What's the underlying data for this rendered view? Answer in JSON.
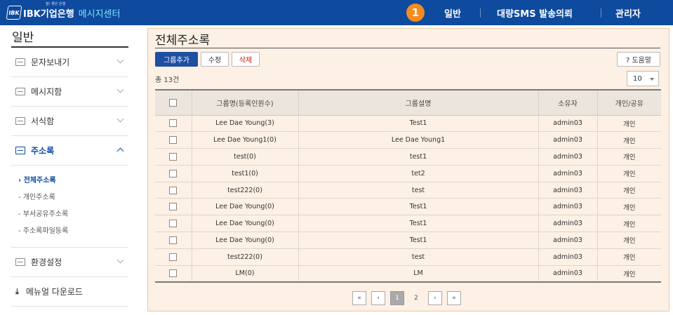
{
  "header": {
    "logo_badge": "IBK",
    "logo_tagline": "참! 좋은 은행",
    "logo_bank": "IBK기업은행",
    "logo_center": "메시지센터",
    "callout_number": "1",
    "nav": [
      {
        "label": "일반"
      },
      {
        "label": "대량SMS 발송의뢰"
      },
      {
        "label": "관리자"
      }
    ]
  },
  "sidebar": {
    "title": "일반",
    "items": [
      {
        "label": "문자보내기"
      },
      {
        "label": "메시지함"
      },
      {
        "label": "서식함"
      },
      {
        "label": "주소록"
      },
      {
        "label": "환경설정"
      },
      {
        "label": "메뉴얼 다운로드"
      }
    ],
    "sub_items": [
      {
        "label": "› 전체주소록"
      },
      {
        "label": "- 개인주소록"
      },
      {
        "label": "- 부서공유주소록"
      },
      {
        "label": "- 주소록파일등록"
      }
    ]
  },
  "main": {
    "title": "전체주소록",
    "buttons": {
      "add_group": "그룹추가",
      "edit": "수정",
      "delete": "삭제",
      "help": "? 도움말"
    },
    "total": "총 13건",
    "page_size": "10",
    "table": {
      "headers": [
        "그룹명(등록인원수)",
        "그룹설명",
        "소유자",
        "개인/공유"
      ],
      "rows": [
        [
          "Lee Dae Young(3)",
          "Test1",
          "admin03",
          "개인"
        ],
        [
          "Lee Dae Young1(0)",
          "Lee Dae Young1",
          "admin03",
          "개인"
        ],
        [
          "test(0)",
          "test1",
          "admin03",
          "개인"
        ],
        [
          "test1(0)",
          "tet2",
          "admin03",
          "개인"
        ],
        [
          "test222(0)",
          "test",
          "admin03",
          "개인"
        ],
        [
          "Lee Dae Young(0)",
          "Test1",
          "admin03",
          "개인"
        ],
        [
          "Lee Dae Young(0)",
          "Test1",
          "admin03",
          "개인"
        ],
        [
          "Lee Dae Young(0)",
          "Test1",
          "admin03",
          "개인"
        ],
        [
          "test222(0)",
          "test",
          "admin03",
          "개인"
        ],
        [
          "LM(0)",
          "LM",
          "admin03",
          "개인"
        ]
      ]
    },
    "pagination": {
      "first": "«",
      "prev": "‹",
      "pages": [
        "1",
        "2"
      ],
      "current": "1",
      "next": "›",
      "last": "»"
    }
  }
}
